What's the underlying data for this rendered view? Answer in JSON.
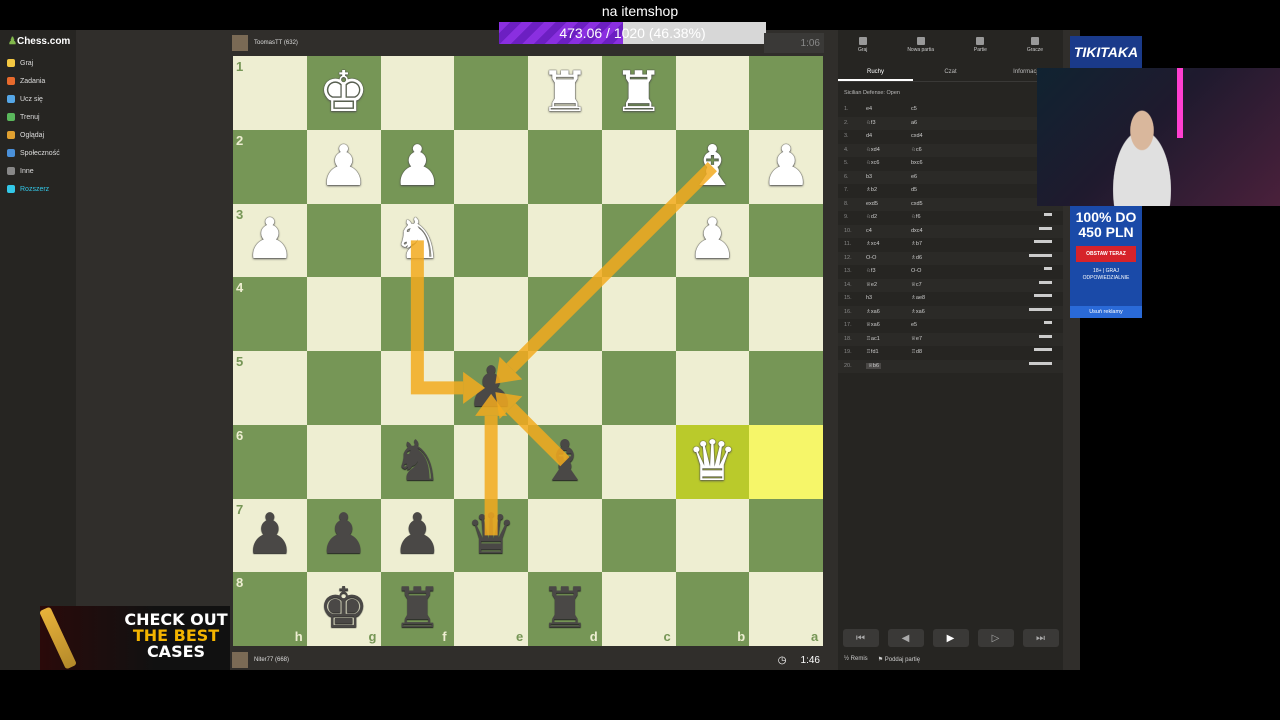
{
  "overlay": {
    "title": "na itemshop",
    "progress_text": "473.06 / 1020 (46.38%)",
    "progress_fraction": 0.4638
  },
  "site": {
    "logo": "Chess.com"
  },
  "nav": {
    "items": [
      {
        "label": "Graj",
        "color": "#f5c842"
      },
      {
        "label": "Zadania",
        "color": "#e86a2c"
      },
      {
        "label": "Ucz się",
        "color": "#55a6e6"
      },
      {
        "label": "Trenuj",
        "color": "#5ab85c"
      },
      {
        "label": "Oglądaj",
        "color": "#e0a030"
      },
      {
        "label": "Społeczność",
        "color": "#4a90d9"
      },
      {
        "label": "Inne",
        "color": "#888888"
      },
      {
        "label": "Rozszerz",
        "color": "#33c8e8"
      }
    ]
  },
  "top_player": {
    "name": "ToomasTT (632)",
    "clock": "1:06"
  },
  "bottom_player": {
    "name": "Niter77 (668)",
    "clock": "1:46"
  },
  "board": {
    "ranks": [
      "1",
      "2",
      "3",
      "4",
      "5",
      "6",
      "7",
      "8"
    ],
    "files": [
      "h",
      "g",
      "f",
      "e",
      "d",
      "c",
      "b",
      "a"
    ],
    "pieces": [
      {
        "sq": "g1",
        "glyph": "♚",
        "color": "w"
      },
      {
        "sq": "d1",
        "glyph": "♜",
        "color": "w"
      },
      {
        "sq": "c1",
        "glyph": "♜",
        "color": "w"
      },
      {
        "sq": "g2",
        "glyph": "♟",
        "color": "w"
      },
      {
        "sq": "f2",
        "glyph": "♟",
        "color": "w"
      },
      {
        "sq": "b2",
        "glyph": "♝",
        "color": "w"
      },
      {
        "sq": "a2",
        "glyph": "♟",
        "color": "w"
      },
      {
        "sq": "h3",
        "glyph": "♟",
        "color": "w"
      },
      {
        "sq": "f3",
        "glyph": "♞",
        "color": "w"
      },
      {
        "sq": "b3",
        "glyph": "♟",
        "color": "w"
      },
      {
        "sq": "e5",
        "glyph": "♟",
        "color": "b"
      },
      {
        "sq": "f6",
        "glyph": "♞",
        "color": "b"
      },
      {
        "sq": "d6",
        "glyph": "♝",
        "color": "b"
      },
      {
        "sq": "b6",
        "glyph": "♛",
        "color": "w"
      },
      {
        "sq": "h7",
        "glyph": "♟",
        "color": "b"
      },
      {
        "sq": "g7",
        "glyph": "♟",
        "color": "b"
      },
      {
        "sq": "f7",
        "glyph": "♟",
        "color": "b"
      },
      {
        "sq": "e7",
        "glyph": "♛",
        "color": "b"
      },
      {
        "sq": "g8",
        "glyph": "♚",
        "color": "b"
      },
      {
        "sq": "f8",
        "glyph": "♜",
        "color": "b"
      },
      {
        "sq": "d8",
        "glyph": "♜",
        "color": "b"
      }
    ],
    "highlights": [
      {
        "sq": "b6",
        "kind": "dark"
      },
      {
        "sq": "a6",
        "kind": "light"
      }
    ],
    "arrows": [
      {
        "from": "f3",
        "via": "f5",
        "to": "e5"
      },
      {
        "from": "b2",
        "to": "e5"
      },
      {
        "from": "d6",
        "to": "e5"
      },
      {
        "from": "e7",
        "to": "e5"
      }
    ]
  },
  "panel": {
    "top_tabs": [
      "Graj",
      "Nowa partia",
      "Partie",
      "Gracze"
    ],
    "sub_tabs": [
      "Ruchy",
      "Czat",
      "Informacj"
    ],
    "opening": "Sicilian Defense: Open",
    "moves": [
      {
        "n": "1.",
        "w": "e4",
        "b": "c5"
      },
      {
        "n": "2.",
        "w": "♘f3",
        "b": "a6"
      },
      {
        "n": "3.",
        "w": "d4",
        "b": "cxd4"
      },
      {
        "n": "4.",
        "w": "♘xd4",
        "b": "♘c6"
      },
      {
        "n": "5.",
        "w": "♘xc6",
        "b": "bxc6"
      },
      {
        "n": "6.",
        "w": "b3",
        "b": "e6"
      },
      {
        "n": "7.",
        "w": "♗b2",
        "b": "d5"
      },
      {
        "n": "8.",
        "w": "exd5",
        "b": "cxd5"
      },
      {
        "n": "9.",
        "w": "♘d2",
        "b": "♘f6"
      },
      {
        "n": "10.",
        "w": "c4",
        "b": "dxc4"
      },
      {
        "n": "11.",
        "w": "♗xc4",
        "b": "♗b7"
      },
      {
        "n": "12.",
        "w": "O-O",
        "b": "♗d6"
      },
      {
        "n": "13.",
        "w": "♘f3",
        "b": "O-O"
      },
      {
        "n": "14.",
        "w": "♕e2",
        "b": "♕c7"
      },
      {
        "n": "15.",
        "w": "h3",
        "b": "♗ae8"
      },
      {
        "n": "16.",
        "w": "♗xa6",
        "b": "♗xa6"
      },
      {
        "n": "17.",
        "w": "♕xa6",
        "b": "e5"
      },
      {
        "n": "18.",
        "w": "♖ac1",
        "b": "♕e7"
      },
      {
        "n": "19.",
        "w": "♖fd1",
        "b": "♖d8"
      },
      {
        "n": "20.",
        "w": "♕b6",
        "b": ""
      }
    ],
    "nav_buttons": [
      "⏮",
      "◀",
      "▶",
      "▷",
      "⏭"
    ],
    "bottom": [
      "Remis",
      "Poddaj partię"
    ]
  },
  "ads": {
    "tiki": "TIKITAKA",
    "bonus_headline": "100% DO 450 PLN",
    "bonus_button": "OBSTAW TERAZ",
    "bonus_small": "18+ | GRAJ ODPOWIEDZIALNIE",
    "remove": "Usuń reklamy"
  },
  "case_banner": {
    "line1": "CHECK OUT",
    "line2": "THE BEST",
    "line3": "CASES"
  }
}
